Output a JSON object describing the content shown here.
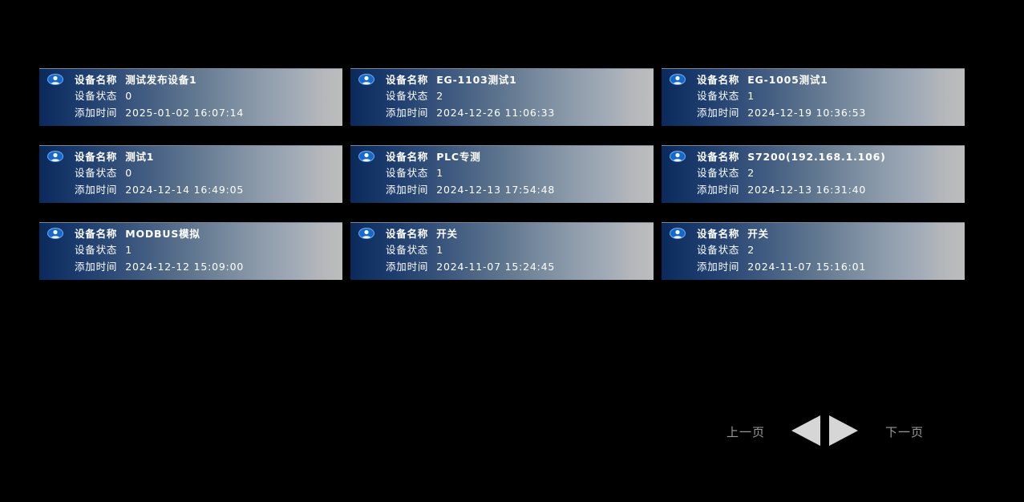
{
  "labels": {
    "name": "设备名称",
    "status": "设备状态",
    "added": "添加时间"
  },
  "devices": [
    {
      "name": "测试发布设备1",
      "status": "0",
      "added": "2025-01-02 16:07:14"
    },
    {
      "name": "EG-1103测试1",
      "status": "2",
      "added": "2024-12-26 11:06:33"
    },
    {
      "name": "EG-1005测试1",
      "status": "1",
      "added": "2024-12-19 10:36:53"
    },
    {
      "name": "测试1",
      "status": "0",
      "added": "2024-12-14 16:49:05"
    },
    {
      "name": "PLC专测",
      "status": "1",
      "added": "2024-12-13 17:54:48"
    },
    {
      "name": "S7200(192.168.1.106)",
      "status": "2",
      "added": "2024-12-13 16:31:40"
    },
    {
      "name": "MODBUS模拟",
      "status": "1",
      "added": "2024-12-12 15:09:00"
    },
    {
      "name": "开关",
      "status": "1",
      "added": "2024-11-07 15:24:45"
    },
    {
      "name": "开关",
      "status": "2",
      "added": "2024-11-07 15:16:01"
    }
  ],
  "pager": {
    "prev_label": "上一页",
    "next_label": "下一页",
    "prev_icon": "triangle-left-icon",
    "next_icon": "triangle-right-icon"
  },
  "colors": {
    "background": "#000000",
    "card_gradient_start": "#0a2a5c",
    "card_gradient_end": "#bdbdbd",
    "icon_blue": "#1769c9",
    "pager_text": "#9a9a9a",
    "pager_arrow": "#d6d6d6"
  }
}
